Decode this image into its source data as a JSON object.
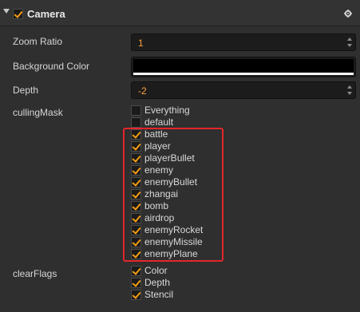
{
  "component": {
    "title": "Camera",
    "enabled": true,
    "icons": {
      "collapse": "collapse-arrow-icon",
      "settings": "gear-icon"
    }
  },
  "fields": {
    "zoom_ratio": {
      "label": "Zoom Ratio",
      "value": "1"
    },
    "background_color": {
      "label": "Background Color",
      "color": "#000000",
      "alpha_bar_color": "#ffffff"
    },
    "depth": {
      "label": "Depth",
      "value": "-2"
    }
  },
  "culling_mask": {
    "label": "cullingMask",
    "items": [
      {
        "label": "Everything",
        "checked": false
      },
      {
        "label": "default",
        "checked": false
      },
      {
        "label": "battle",
        "checked": true
      },
      {
        "label": "player",
        "checked": true
      },
      {
        "label": "playerBullet",
        "checked": true
      },
      {
        "label": "enemy",
        "checked": true
      },
      {
        "label": "enemyBullet",
        "checked": true
      },
      {
        "label": "zhangai",
        "checked": true
      },
      {
        "label": "bomb",
        "checked": true
      },
      {
        "label": "airdrop",
        "checked": true
      },
      {
        "label": "enemyRocket",
        "checked": true
      },
      {
        "label": "enemyMissile",
        "checked": true
      },
      {
        "label": "enemyPlane",
        "checked": true
      }
    ]
  },
  "clear_flags": {
    "label": "clearFlags",
    "items": [
      {
        "label": "Color",
        "checked": true
      },
      {
        "label": "Depth",
        "checked": true
      },
      {
        "label": "Stencil",
        "checked": true
      }
    ]
  },
  "colors": {
    "accent": "#f39c12",
    "value_text": "#ffa13a",
    "highlight_border": "#e4262c"
  }
}
